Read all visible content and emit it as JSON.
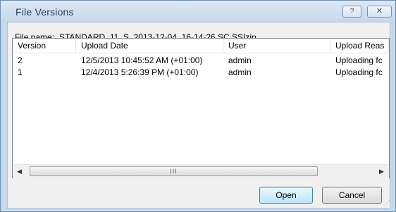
{
  "window": {
    "title": "File Versions",
    "help_label": "?",
    "close_label": "✕"
  },
  "file_name": {
    "label": "File name:",
    "value": "STANDARD_11_S  2013-12-04  16-14-26.SC.SSIzip"
  },
  "list": {
    "columns": [
      "Version",
      "Upload Date",
      "User",
      "Upload Reas"
    ],
    "rows": [
      [
        "2",
        "12/5/2013 10:45:52 AM (+01:00)",
        "admin",
        "Uploading fc"
      ],
      [
        "1",
        "12/4/2013 5:26:39 PM (+01:00)",
        "admin",
        "Uploading fc"
      ]
    ]
  },
  "scrollbar": {
    "left_arrow": "◀",
    "right_arrow": "▶",
    "thumb_grip": "III"
  },
  "buttons": {
    "open": "Open",
    "cancel": "Cancel"
  }
}
